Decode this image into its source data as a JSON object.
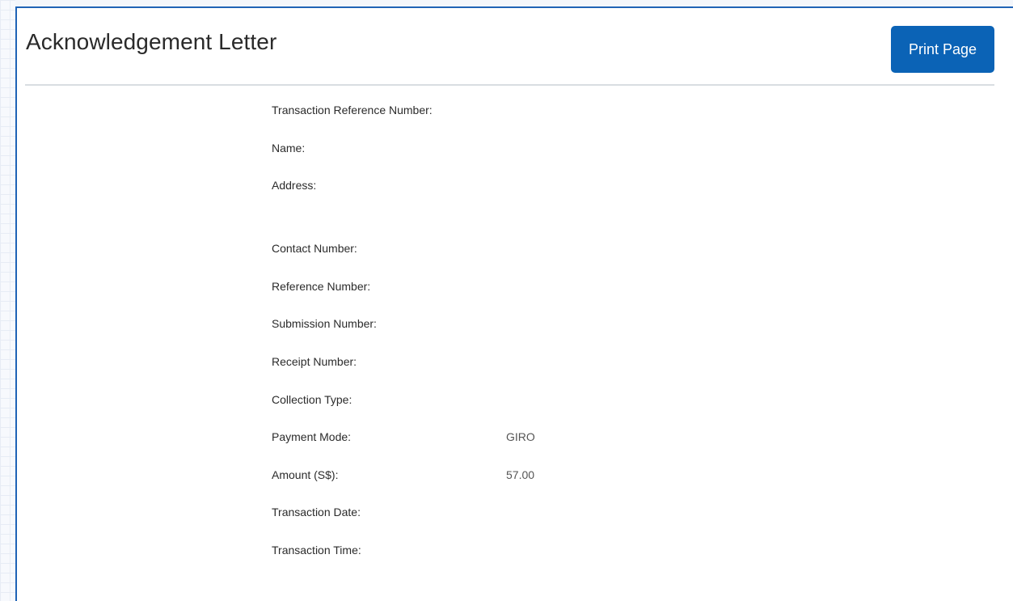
{
  "header": {
    "title": "Acknowledgement Letter",
    "print_button_label": "Print Page"
  },
  "colors": {
    "accent": "#0b63b6",
    "frame_border": "#1f63b6",
    "divider": "#d9dde2"
  },
  "details": [
    {
      "label": "Transaction Reference Number:",
      "value": ""
    },
    {
      "label": "Name:",
      "value": ""
    },
    {
      "label": "Address:",
      "value": ""
    },
    {
      "label": "Contact Number:",
      "value": ""
    },
    {
      "label": "Reference Number:",
      "value": ""
    },
    {
      "label": "Submission Number:",
      "value": ""
    },
    {
      "label": "Receipt Number:",
      "value": ""
    },
    {
      "label": "Collection Type:",
      "value": ""
    },
    {
      "label": "Payment Mode:",
      "value": "GIRO"
    },
    {
      "label": "Amount (S$):",
      "value": "57.00"
    },
    {
      "label": "Transaction Date:",
      "value": ""
    },
    {
      "label": "Transaction Time:",
      "value": ""
    }
  ]
}
